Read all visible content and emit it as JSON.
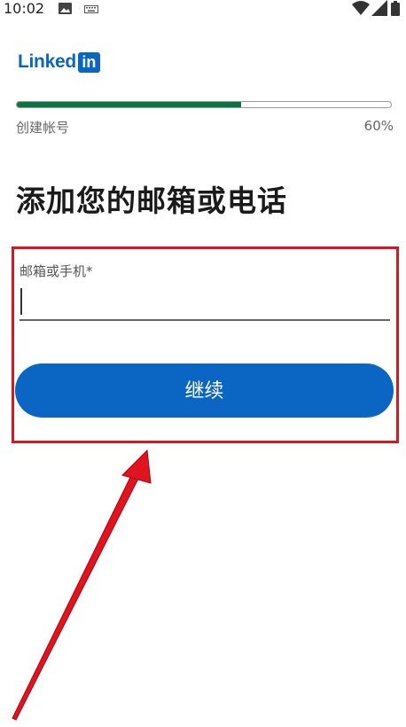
{
  "status_bar": {
    "time": "10:02",
    "icons": [
      "image-icon",
      "keyboard-icon",
      "wifi-icon",
      "signal-icon",
      "battery-icon"
    ]
  },
  "brand": {
    "word": "Linked",
    "box": "in",
    "color": "#0a66c2"
  },
  "progress": {
    "label": "创建帐号",
    "percent_text": "60%",
    "value": 0.6,
    "fill_color": "#057642"
  },
  "page": {
    "title": "添加您的邮箱或电话"
  },
  "form": {
    "field_label": "邮箱或手机*",
    "field_value": "",
    "continue_label": "继续"
  },
  "annotation": {
    "highlight_color": "#e0141e"
  }
}
